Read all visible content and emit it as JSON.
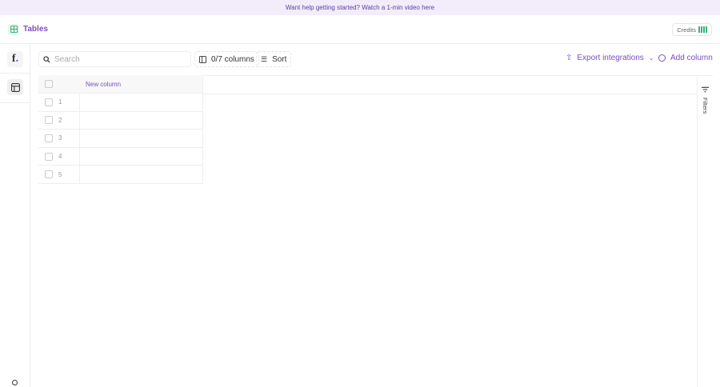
{
  "banner": {
    "text": "Want help getting started? Watch a 1-min video here"
  },
  "header": {
    "title": "Tables",
    "credits_label": "Credits"
  },
  "sidebar": {
    "logo": "f."
  },
  "toolbar": {
    "search_placeholder": "Search",
    "search_value": "",
    "columns_label": "0/7 columns",
    "sort_label": "Sort",
    "export_label": "Export integrations",
    "add_column_label": "Add column"
  },
  "table": {
    "columns": [
      "New column"
    ],
    "rows": [
      "1",
      "2",
      "3",
      "4",
      "5"
    ]
  },
  "filters": {
    "label": "Filters"
  },
  "colors": {
    "accent": "#7a4fc2",
    "credits": "#35b27a"
  }
}
